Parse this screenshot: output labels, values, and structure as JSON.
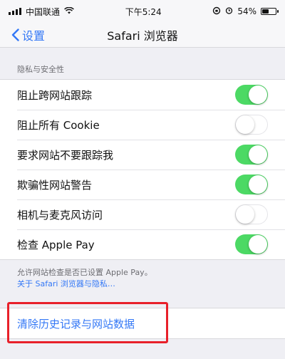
{
  "status_bar": {
    "carrier": "中国联通",
    "time": "下午5:24",
    "battery": "54%",
    "battery_level": 0.54
  },
  "nav": {
    "back_label": "设置",
    "title": "Safari 浏览器"
  },
  "privacy_section": {
    "header": "隐私与安全性",
    "rows": [
      {
        "label": "阻止跨网站跟踪",
        "on": true
      },
      {
        "label": "阻止所有 Cookie",
        "on": false
      },
      {
        "label": "要求网站不要跟踪我",
        "on": true
      },
      {
        "label": "欺骗性网站警告",
        "on": true
      },
      {
        "label": "相机与麦克风访问",
        "on": false
      },
      {
        "label": "检查 Apple Pay",
        "on": true
      }
    ],
    "footer_text": "允许网站检查是否已设置 Apple Pay。",
    "footer_link": "关于 Safari 浏览器与隐私…"
  },
  "clear_history": {
    "label": "清除历史记录与网站数据"
  },
  "colors": {
    "accent": "#3478f6",
    "toggle_on": "#4cd964",
    "highlight": "#e8202a"
  }
}
